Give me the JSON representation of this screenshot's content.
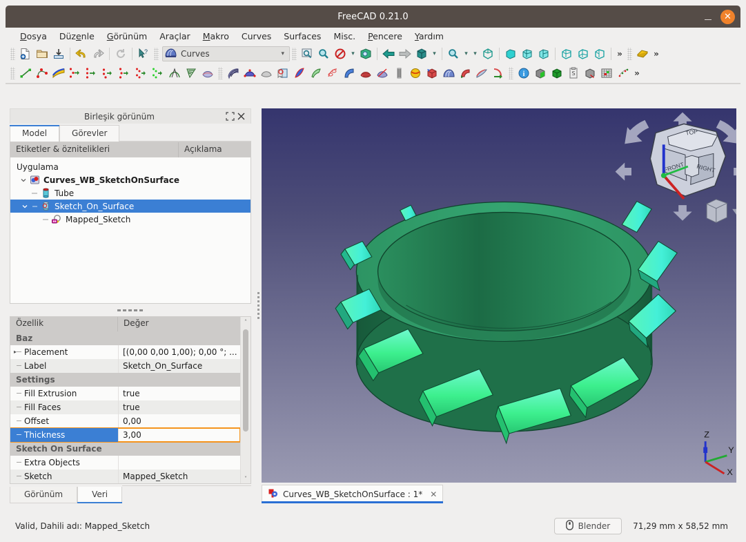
{
  "window": {
    "title": "FreeCAD 0.21.0",
    "minimize_label": "–",
    "close_label": "✕"
  },
  "menubar": {
    "items": [
      {
        "label": "Dosya",
        "accel_index": 0
      },
      {
        "label": "Düzenle",
        "accel_index": 3
      },
      {
        "label": "Görünüm",
        "accel_index": 0
      },
      {
        "label": "Araçlar",
        "accel_index": -1
      },
      {
        "label": "Makro",
        "accel_index": 0
      },
      {
        "label": "Curves",
        "accel_index": -1
      },
      {
        "label": "Surfaces",
        "accel_index": -1
      },
      {
        "label": "Misc.",
        "accel_index": -1
      },
      {
        "label": "Pencere",
        "accel_index": 0
      },
      {
        "label": "Yardım",
        "accel_index": 0
      }
    ]
  },
  "toolbar": {
    "workbench_selector": {
      "value": "Curves",
      "icon": "curves-workbench-icon",
      "arrow": "▾"
    },
    "file_icons": [
      "new-document-icon",
      "open-folder-icon",
      "save-icon"
    ],
    "edit_icons": [
      "undo-icon",
      "redo-icon",
      "refresh-icon",
      "whats-this-icon"
    ],
    "view_icons": [
      "fit-all-icon",
      "zoom-fit-selection-icon",
      "draw-style-icon",
      "axonometric-view-icon",
      "back-arrow-icon",
      "forward-arrow-icon",
      "std-view-icon",
      "zoom-box-icon",
      "isometric-icon",
      "front-view-icon",
      "top-view-icon",
      "right-view-icon",
      "rear-view-icon",
      "bottom-view-icon",
      "left-view-icon"
    ],
    "overflow_label": "»",
    "measure_icon": "measure-icon",
    "curves_icons": [
      "line-icon",
      "bspline-icon",
      "editable-spline-icon",
      "join-curve-icon",
      "discretize-icon",
      "approximate-icon",
      "interpolate-icon",
      "parametric-blend-icon",
      "curve-extend-icon",
      "curve-on-mesh-icon",
      "blend-surface-icon",
      "gordon-surface-icon"
    ],
    "surfaces_icons": [
      "isocurves-icon",
      "profile-support-icon",
      "flatten-face-icon",
      "sketch-on-surface-icon",
      "sublink-icon",
      "pipeshell-icon",
      "pipeshell-profile-icon",
      "sweep2rails-icon",
      "surface-trim-icon",
      "reflect-lines-icon",
      "zebra-icon",
      "sphere-map-icon"
    ],
    "misc_icons": [
      "solid-icon",
      "curves-icon",
      "pipe-icon",
      "mixed-curve-icon",
      "segment-surface-icon"
    ],
    "info_icons": [
      "info-icon",
      "shape-info-icon",
      "solid-green-icon",
      "clipboard-icon",
      "compound-icon",
      "grid-icon",
      "point-cloud-icon"
    ]
  },
  "combo_view": {
    "title": "Birleşik görünüm",
    "undock_icon": "undock-icon",
    "close_icon": "close-icon",
    "tabs": [
      {
        "label": "Model",
        "active": true
      },
      {
        "label": "Görevler",
        "active": false
      }
    ]
  },
  "tree": {
    "columns": [
      "Etiketler & öznitelikleri",
      "Açıklama"
    ],
    "root": "Uygulama",
    "nodes": [
      {
        "label": "Curves_WB_SketchOnSurface",
        "depth": 1,
        "icon": "document-icon",
        "bold": true,
        "expanded": true,
        "selected": false
      },
      {
        "label": "Tube",
        "depth": 2,
        "icon": "tube-icon",
        "bold": false,
        "expanded": null,
        "selected": false
      },
      {
        "label": "Sketch_On_Surface",
        "depth": 2,
        "icon": "sketch-on-surface-icon",
        "bold": false,
        "expanded": true,
        "selected": true
      },
      {
        "label": "Mapped_Sketch",
        "depth": 3,
        "icon": "sketch-icon",
        "bold": false,
        "expanded": null,
        "selected": false
      }
    ]
  },
  "properties": {
    "columns": [
      "Özellik",
      "Değer"
    ],
    "rows": [
      {
        "type": "group",
        "name": "Baz",
        "value": ""
      },
      {
        "type": "item",
        "name": "Placement",
        "value": "[(0,00 0,00 1,00); 0,00 °; ...",
        "expandable": true,
        "selected": false,
        "highlight": false
      },
      {
        "type": "item",
        "name": "Label",
        "value": "Sketch_On_Surface",
        "expandable": false,
        "selected": false,
        "highlight": false
      },
      {
        "type": "group",
        "name": "Settings",
        "value": ""
      },
      {
        "type": "item",
        "name": "Fill Extrusion",
        "value": "true",
        "expandable": false,
        "selected": false,
        "highlight": false
      },
      {
        "type": "item",
        "name": "Fill Faces",
        "value": "true",
        "expandable": false,
        "selected": false,
        "highlight": false
      },
      {
        "type": "item",
        "name": "Offset",
        "value": "0,00",
        "expandable": false,
        "selected": false,
        "highlight": false
      },
      {
        "type": "item",
        "name": "Thickness",
        "value": "3,00",
        "expandable": false,
        "selected": true,
        "highlight": true
      },
      {
        "type": "group",
        "name": "Sketch On Surface",
        "value": ""
      },
      {
        "type": "item",
        "name": "Extra Objects",
        "value": "",
        "expandable": false,
        "selected": false,
        "highlight": false
      },
      {
        "type": "item",
        "name": "Sketch",
        "value": "Mapped_Sketch",
        "expandable": false,
        "selected": false,
        "highlight": false
      }
    ],
    "scroll_up_icon": "˄",
    "scroll_down_icon": "˅"
  },
  "bottom_tabs": [
    {
      "label": "Görünüm",
      "active": false
    },
    {
      "label": "Veri",
      "active": true
    }
  ],
  "viewport": {
    "navigation_cube": {
      "top_label": "TOP",
      "front_label": "FRONT",
      "right_label": "RIGHT",
      "corner_button_icon": "view-corner-icon",
      "menu_arrow": "▾"
    },
    "axis_indicator": {
      "x_label": "X",
      "y_label": "Y",
      "z_label": "Z",
      "x_color": "#cc2222",
      "y_color": "#22aa33",
      "z_color": "#2233cc"
    },
    "model": {
      "tube_color": "#2e9160",
      "tube_shade_dark": "#1f6b46",
      "feature_color": "#3cf08c",
      "feature_highlight": "#5ef5d0",
      "edge_color": "#123a28"
    },
    "background_top": "#35356e",
    "background_bottom": "#9a9ab2"
  },
  "document_tabs": [
    {
      "label": "Curves_WB_SketchOnSurface : 1*",
      "icon": "freecad-doc-icon",
      "close": "✕",
      "active": true
    }
  ],
  "statusbar": {
    "message": "Valid, Dahili adı: Mapped_Sketch",
    "nav_button": {
      "label": "Blender",
      "icon": "mouse-icon"
    },
    "dimensions": "71,29 mm x 58,52 mm"
  }
}
